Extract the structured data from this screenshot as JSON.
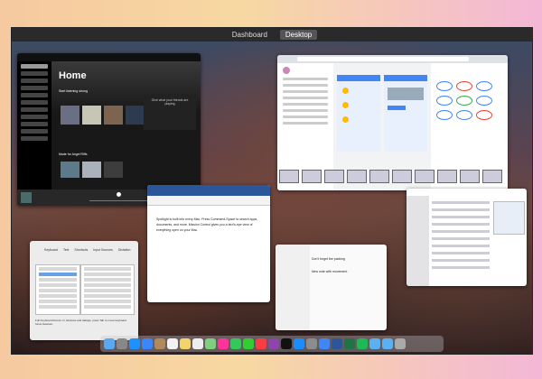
{
  "spaces_bar": {
    "tabs": [
      "Dashboard",
      "Desktop"
    ],
    "active": "Desktop"
  },
  "spotify": {
    "home_title": "Home",
    "section1": "Start listening strong",
    "section2": "Made for Angel Riffs",
    "promo": "Give what your friends are playing"
  },
  "word": {
    "body": "Spotlight is built into every Mac. Press Command-Space to search apps, documents, and more. Mission Control gives you a bird's-eye view of everything open on your Mac."
  },
  "prefs": {
    "tabs": [
      "Keyboard",
      "Text",
      "Shortcuts",
      "Input Sources",
      "Dictation"
    ],
    "footer": "Full Keyboard Access: In windows and dialogs, press Tab to move keyboard focus between"
  },
  "notes": {
    "items": [
      "Don't forget the packing",
      "New note with movement"
    ]
  },
  "dock": {
    "icons": [
      "finder-icon",
      "launchpad-icon",
      "safari-icon",
      "mail-icon",
      "contacts-icon",
      "calendar-icon",
      "notes-icon",
      "reminders-icon",
      "maps-icon",
      "photos-icon",
      "messages-icon",
      "facetime-icon",
      "music-icon",
      "podcasts-icon",
      "tv-icon",
      "app-store-icon",
      "system-preferences-icon",
      "chrome-icon",
      "word-icon",
      "excel-icon",
      "spotify-icon",
      "folder-icon",
      "downloads-icon",
      "trash-icon"
    ],
    "colors": [
      "#5aa9f0",
      "#888",
      "#1e90ff",
      "#3a86ff",
      "#b08a5a",
      "#f2f2f2",
      "#f3d36b",
      "#eee",
      "#7ecf7e",
      "#f39",
      "#34c759",
      "#3c3",
      "#fc3c44",
      "#8e44ad",
      "#111",
      "#1a8cff",
      "#8c8c8c",
      "#4285f4",
      "#2b579a",
      "#217346",
      "#1db954",
      "#5ab0f0",
      "#5ab0f0",
      "#aaa"
    ]
  }
}
